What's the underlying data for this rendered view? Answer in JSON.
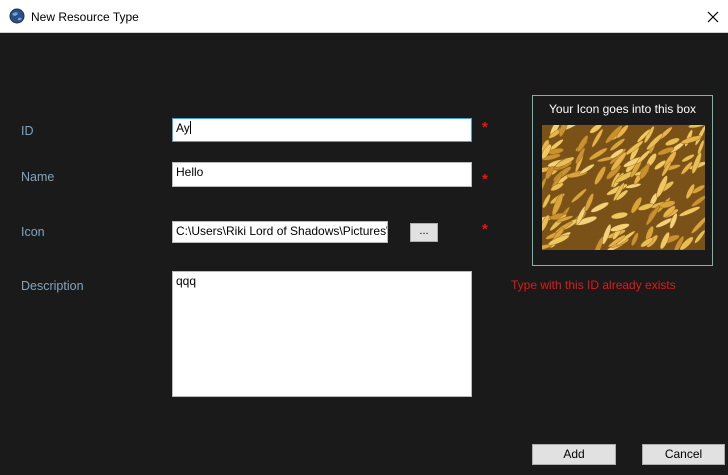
{
  "window": {
    "title": "New Resource Type",
    "icon": "globe-icon",
    "close_symbol": "✕"
  },
  "form": {
    "id": {
      "label": "ID",
      "value": "Ay",
      "required_mark": "*"
    },
    "name": {
      "label": "Name",
      "value": "Hello",
      "required_mark": "*"
    },
    "icon": {
      "label": "Icon",
      "value": "C:\\Users\\Riki Lord of Shadows\\Pictures\\F",
      "required_mark": "*",
      "browse_label": "..."
    },
    "description": {
      "label": "Description",
      "value": "qqq"
    }
  },
  "error_message": "Type with this ID already exists",
  "icon_preview": {
    "caption": "Your Icon goes into this box",
    "image": "grain-photo"
  },
  "buttons": {
    "add": "Add",
    "cancel": "Cancel"
  },
  "colors": {
    "background": "#1a1a1a",
    "label": "#7ea6c2",
    "required": "#e01a1a",
    "error": "#e01a1a",
    "icon_box_border": "#6fbba5",
    "focus_border": "#4a9ed8"
  }
}
